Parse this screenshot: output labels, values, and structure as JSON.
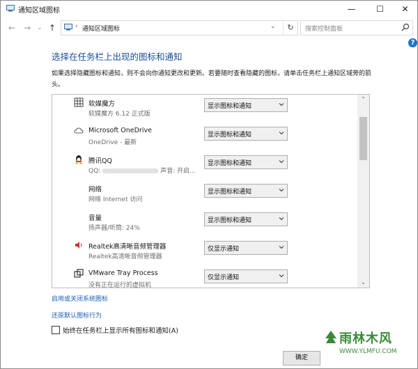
{
  "window": {
    "title": "通知区域图标",
    "controls": {
      "minimize": "—",
      "maximize": "☐",
      "close": "✕"
    }
  },
  "address": {
    "back": "←",
    "forward": "→",
    "dropdown": "⌄",
    "up": "↑",
    "separator": "›",
    "path": "通知区域图标",
    "path_dropdown": "⌄",
    "refresh": "↻",
    "search_placeholder": "搜索控制面板"
  },
  "help": "?",
  "main": {
    "title": "选择在任务栏上出现的图标和通知",
    "description": "如果选择隐藏图标和通知，则不会向你通知更改和更新。若要随时查看隐藏的图标，请单击任务栏上通知区域旁的箭头。"
  },
  "list": {
    "rows": [
      {
        "icon": "grid-icon",
        "name": "软媒魔方",
        "sub": "软媒魔方 6.12 正式版",
        "behavior": "显示图标和通知"
      },
      {
        "icon": "cloud-icon",
        "name": "Microsoft OneDrive",
        "sub": "OneDrive - 最新",
        "behavior": "显示图标和通知"
      },
      {
        "icon": "qq-penguin-icon",
        "name": "腾讯QQ",
        "sub": "QQ:",
        "sub_suffix": "声音: 开启...",
        "behavior": "显示图标和通知"
      },
      {
        "icon": "network-icon",
        "name": "网络",
        "sub": "网络 Internet 访问",
        "behavior": "显示图标和通知"
      },
      {
        "icon": "volume-icon",
        "name": "音量",
        "sub": "扬声器/听筒: 24%",
        "behavior": "显示图标和通知"
      },
      {
        "icon": "speaker-icon",
        "name": "Realtek高清晰音频管理器",
        "sub": "Realtek高清晰音频管理器",
        "behavior": "仅显示通知"
      },
      {
        "icon": "vmware-icon",
        "name": "VMware Tray Process",
        "sub": "没有正在运行的虚拟机",
        "behavior": "仅显示通知"
      }
    ],
    "scroll": {
      "up": "⌃",
      "down": "⌄"
    }
  },
  "links": {
    "system_icons": "启用或关闭系统图标",
    "restore_default": "还原默认图标行为"
  },
  "checkbox": {
    "label": "始终在任务栏上显示所有图标和通知(A)",
    "checked": false
  },
  "footer": {
    "ok_label": "确定"
  },
  "watermark": {
    "text": "雨林木风",
    "sub": "WWW.YLMFU.COM"
  },
  "colors": {
    "title_blue": "#1a4e9a",
    "link_blue": "#1a5fb4",
    "help_blue": "#1a73c9",
    "watermark_green": "#3a8a3a"
  }
}
